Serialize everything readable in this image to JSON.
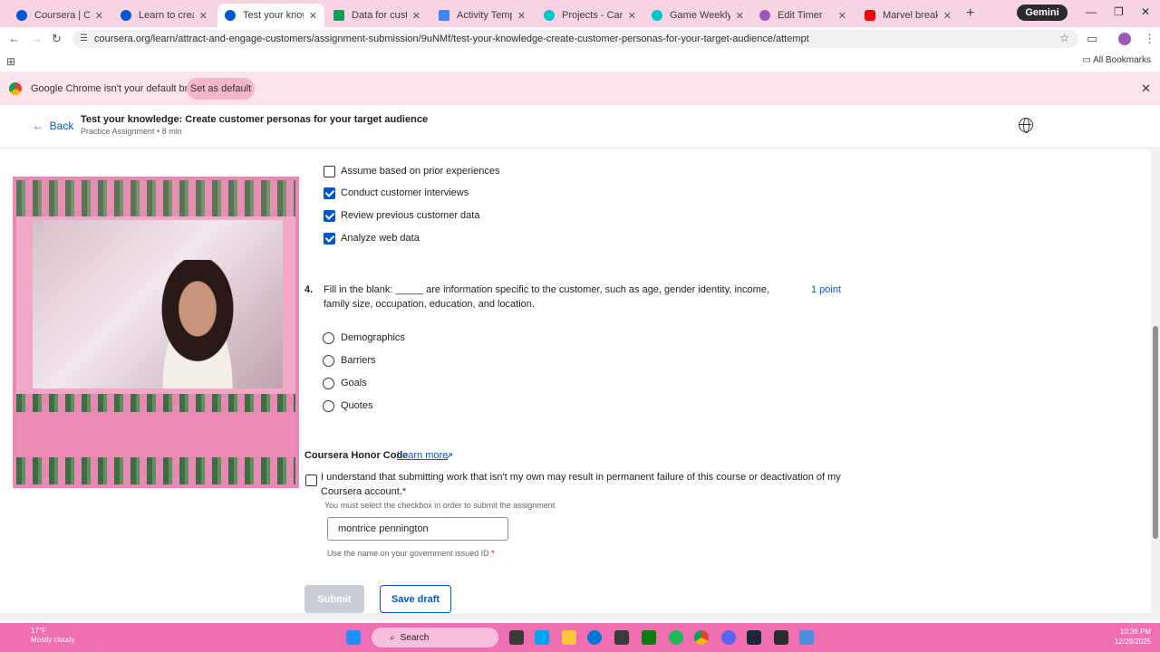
{
  "browser": {
    "tabs": [
      {
        "label": "Coursera | Online C",
        "color": "#0056d2",
        "active": false
      },
      {
        "label": "Learn to create cus",
        "color": "#0056d2",
        "active": false
      },
      {
        "label": "Test your knowledg",
        "color": "#0056d2",
        "active": true
      },
      {
        "label": "Data for customer p",
        "color": "#0f9d58",
        "active": false
      },
      {
        "label": "Activity Template: C",
        "color": "#4285f4",
        "active": false
      },
      {
        "label": "Projects - Canva",
        "color": "#00c4cc",
        "active": false
      },
      {
        "label": "Game Weekly Sche",
        "color": "#00c4cc",
        "active": false
      },
      {
        "label": "Edit Timer",
        "color": "#9b59b6",
        "active": false
      },
      {
        "label": "Marvel break down",
        "color": "#ff0000",
        "active": false
      }
    ],
    "new_tab_label": "+",
    "gemini_label": "Gemini",
    "url": "coursera.org/learn/attract-and-engage-customers/assignment-submission/9uNMf/test-your-knowledge-create-customer-personas-for-your-target-audience/attempt",
    "all_bookmarks_label": "All Bookmarks"
  },
  "infobar": {
    "message": "Google Chrome isn't your default browser",
    "set_default_label": "Set as default"
  },
  "header": {
    "back_label": "Back",
    "title": "Test your knowledge: Create customer personas for your target audience",
    "subtitle": "Practice Assignment • 8 min"
  },
  "prev_question": {
    "options": [
      {
        "label": "Assume based on prior experiences",
        "checked": false
      },
      {
        "label": "Conduct customer interviews",
        "checked": true
      },
      {
        "label": "Review previous customer data",
        "checked": true
      },
      {
        "label": "Analyze web data",
        "checked": true
      }
    ]
  },
  "question4": {
    "number": "4.",
    "text": "Fill in the blank: _____ are information specific to the customer, such as age, gender identity, income, family size, occupation, education, and location.",
    "points": "1 point",
    "options": [
      {
        "label": "Demographics"
      },
      {
        "label": "Barriers"
      },
      {
        "label": "Goals"
      },
      {
        "label": "Quotes"
      }
    ]
  },
  "honor_code": {
    "title": "Coursera Honor Code",
    "learn_more": "Learn more",
    "statement": "I understand that submitting work that isn't my own may result in permanent failure of this course or deactivation of my Coursera account.*",
    "must_select": "You must select the checkbox in order to submit the assignment",
    "name_value": "montrice pennington",
    "name_hint": "Use the name on your government issued ID",
    "required_mark": "*"
  },
  "actions": {
    "submit_label": "Submit",
    "save_draft_label": "Save draft"
  },
  "taskbar": {
    "weather_temp": "17°F",
    "weather_desc": "Mostly cloudy",
    "search_placeholder": "Search",
    "time": "10:36 PM",
    "date": "12/29/2025"
  },
  "colors": {
    "accent": "#0056d2",
    "tabstrip": "#f7d3e3",
    "taskbar": "#ef6fb3"
  }
}
